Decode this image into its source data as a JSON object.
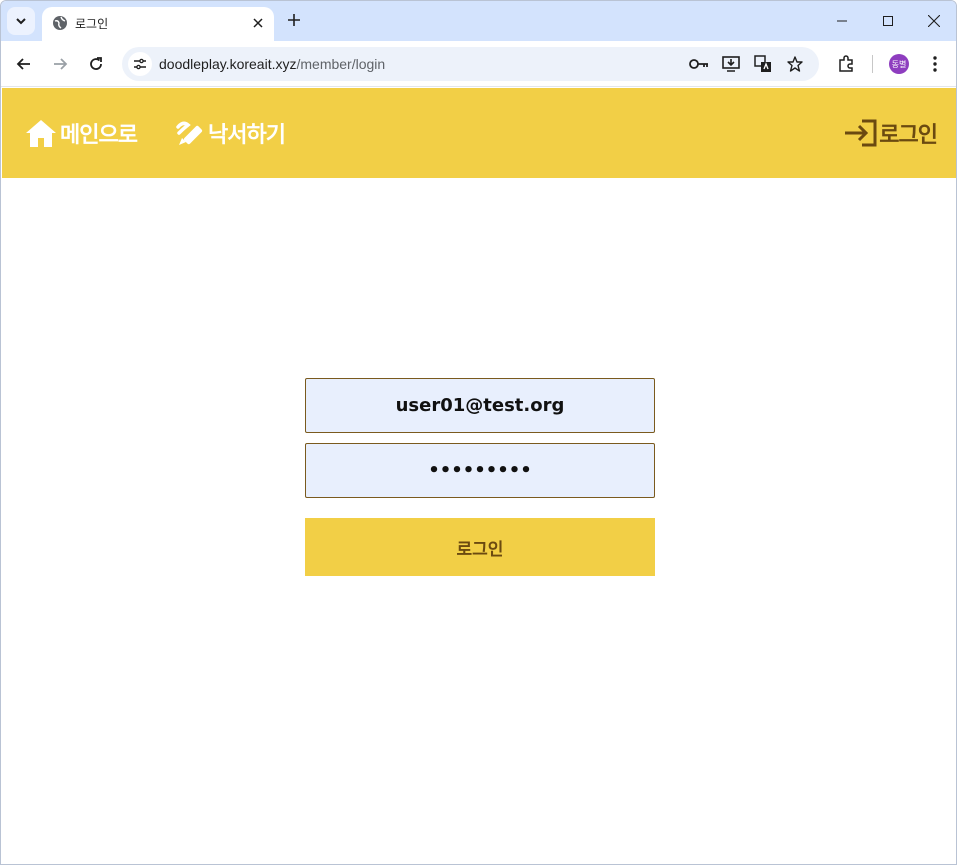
{
  "browser": {
    "tab": {
      "title": "로그인",
      "favicon": "globe-icon"
    },
    "url": {
      "host": "doodleplay.koreait.xyz",
      "path": "/member/login"
    },
    "profile": {
      "initials": "동별",
      "color": "#8e3dbf"
    }
  },
  "header": {
    "background": "#f2cf46",
    "nav": [
      {
        "label": "메인으로",
        "icon": "home-icon"
      },
      {
        "label": "낙서하기",
        "icon": "pencil-icon"
      }
    ],
    "login": {
      "label": "로그인",
      "icon": "login-arrow-icon"
    }
  },
  "form": {
    "email": {
      "value": "user01@test.org"
    },
    "password": {
      "value": "•••••••••"
    },
    "submit_label": "로그인"
  }
}
